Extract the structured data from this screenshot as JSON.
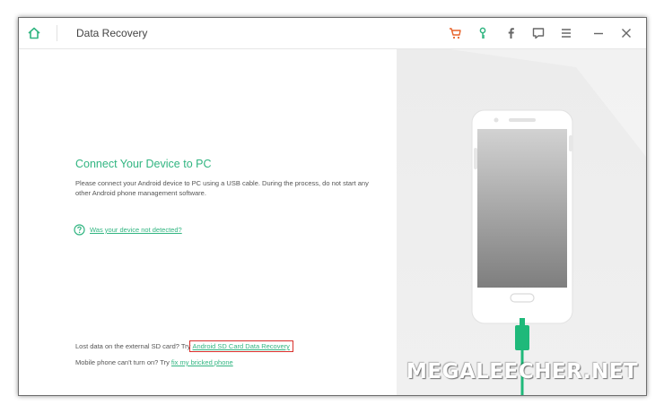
{
  "window": {
    "title": "Data Recovery"
  },
  "titlebar_icons": [
    "home-icon",
    "cart-icon",
    "key-icon",
    "facebook-icon",
    "feedback-icon",
    "menu-icon",
    "minimize-icon",
    "close-icon"
  ],
  "main": {
    "heading": "Connect Your Device to PC",
    "description": "Please connect your Android device to PC using a USB cable. During the process, do not start any other Android phone management software.",
    "help_link": "Was your device not detected?"
  },
  "footer": {
    "sd_prefix": "Lost data on the external SD card? Try",
    "sd_link": "Android SD Card Data Recovery",
    "brick_prefix": "Mobile phone can't turn on? Try",
    "brick_link": "fix my bricked phone"
  },
  "watermark": "MEGALEECHER.NET",
  "colors": {
    "accent": "#31b581",
    "cart": "#e8632a",
    "highlight_box": "#d9302c",
    "cable": "#1fb97a"
  }
}
